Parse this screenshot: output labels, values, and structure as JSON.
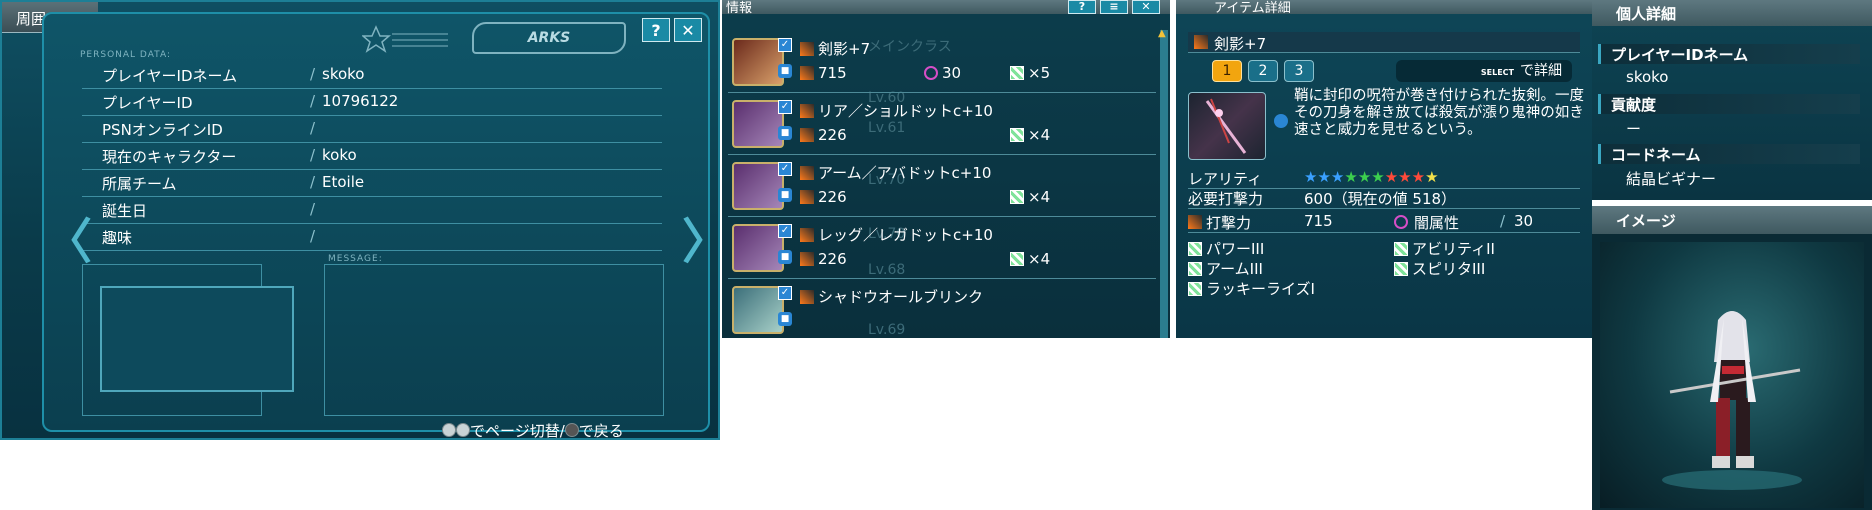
{
  "card": {
    "tab_label": "周囲の",
    "logo_text": "ARKS",
    "logo2_text": "ARKS",
    "help_label": "?",
    "close_label": "✕",
    "section_personal": "PERSONAL DATA:",
    "section_message": "MESSAGE:",
    "rows": [
      {
        "label": "プレイヤーIDネーム",
        "value": "skoko"
      },
      {
        "label": "プレイヤーID",
        "value": "10796122"
      },
      {
        "label": "PSNオンラインID",
        "value": ""
      },
      {
        "label": "現在のキャラクター",
        "value": "koko"
      },
      {
        "label": "所属チーム",
        "value": "Etoile"
      },
      {
        "label": "誕生日",
        "value": ""
      },
      {
        "label": "趣味",
        "value": ""
      }
    ],
    "separator": "/",
    "footer_page": "でページ切替/",
    "footer_back": "で戻る",
    "left_arrow": "〈",
    "right_arrow": "〉"
  },
  "equip": {
    "title": "情報",
    "rows": [
      {
        "name": "剣影+7",
        "atk": "715",
        "elem": "30",
        "slots": "×5",
        "icon": "weapon"
      },
      {
        "name": "リア／ショルドットc+10",
        "atk": "226",
        "elem": "",
        "slots": "×4",
        "icon": "unit"
      },
      {
        "name": "アーム／アバドットc+10",
        "atk": "226",
        "elem": "",
        "slots": "×4",
        "icon": "unit"
      },
      {
        "name": "レッグ／レガドットc+10",
        "atk": "226",
        "elem": "",
        "slots": "×4",
        "icon": "unit"
      },
      {
        "name": "シャドウオールブリンク",
        "atk": "",
        "elem": "",
        "slots": "",
        "icon": "char"
      }
    ],
    "ghost_texts": [
      "メインクラス",
      "Lv.60",
      "Lv.61",
      "Lv.70",
      "Lv.70",
      "Lv.68",
      "Lv.69"
    ]
  },
  "detail": {
    "title": "アイテム詳細",
    "item_name": "剣影+7",
    "pages": [
      "1",
      "2",
      "3"
    ],
    "select_badge": "SELECT",
    "detail_hint": "で詳細",
    "description": "鞘に封印の呪符が巻き付けられた抜剣。一度その刀身を解き放てば殺気が漲り鬼神の如き速さと威力を見せるという。",
    "rarity_label": "レアリティ",
    "rarity_stars": [
      "#3aa0ff",
      "#3aa0ff",
      "#3aa0ff",
      "#3ccf4e",
      "#3ccf4e",
      "#3ccf4e",
      "#ff4a3a",
      "#ff4a3a",
      "#ff4a3a",
      "#f2e04a"
    ],
    "req_label": "必要打撃力",
    "req_value": "600（現在の値 518）",
    "atk_label": "打撃力",
    "atk_value": "715",
    "elem_label": "闇属性",
    "elem_value": "30",
    "abilities_left": [
      "パワーIII",
      "アームIII",
      "ラッキーライズI"
    ],
    "abilities_right": [
      "アビリティII",
      "スピリタIII"
    ]
  },
  "pdetail": {
    "title": "個人詳細",
    "rows": [
      {
        "label": "プレイヤーIDネーム",
        "value": "skoko"
      },
      {
        "label": "貢献度",
        "value": "ー"
      },
      {
        "label": "コードネーム",
        "value": "結晶ビギナー"
      }
    ]
  },
  "image": {
    "title": "イメージ"
  },
  "colors": {
    "panel_bg": "#0a3b4a",
    "accent": "#1a8aa5",
    "border": "#4e8b99",
    "active_page": "#f2a50f"
  }
}
